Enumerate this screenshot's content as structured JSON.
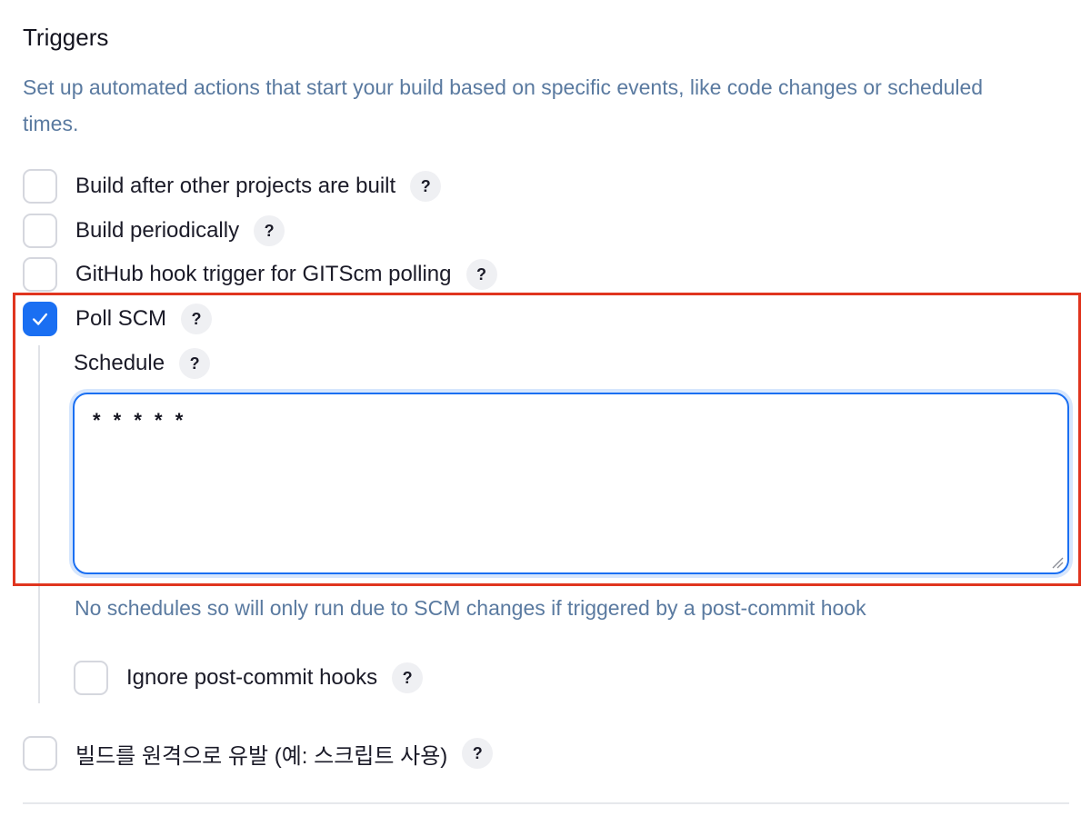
{
  "section": {
    "title": "Triggers",
    "description": "Set up automated actions that start your build based on specific events, like code changes or scheduled times."
  },
  "help_glyph": "?",
  "triggers": [
    {
      "label": "Build after other projects are built",
      "checked": false
    },
    {
      "label": "Build periodically",
      "checked": false
    },
    {
      "label": "GitHub hook trigger for GITScm polling",
      "checked": false
    },
    {
      "label": "Poll SCM",
      "checked": true
    },
    {
      "label": "빌드를 원격으로 유발 (예: 스크립트 사용)",
      "checked": false
    }
  ],
  "poll_scm": {
    "schedule_label": "Schedule",
    "schedule_value": "* * * * *",
    "note": "No schedules so will only run due to SCM changes if triggered by a post-commit hook",
    "ignore_hooks_label": "Ignore post-commit hooks",
    "ignore_hooks_checked": false
  },
  "colors": {
    "accent": "#1a6ff2",
    "description_text": "#5a7aa0",
    "highlight_border": "#e0351f"
  },
  "icons": {
    "checkmark": "check-icon",
    "help": "help-icon",
    "resize": "resize-grip-icon"
  }
}
